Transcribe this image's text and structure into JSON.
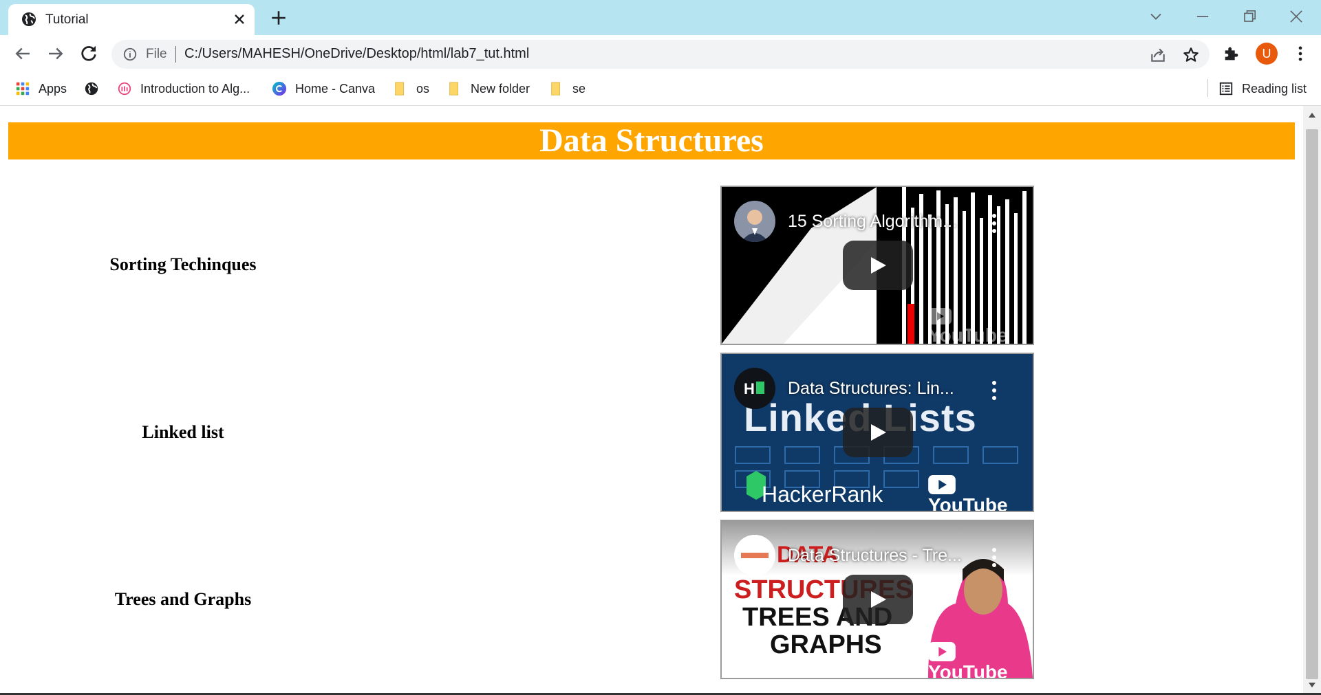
{
  "browser": {
    "tab_title": "Tutorial",
    "address_scheme": "File",
    "address_url": "C:/Users/MAHESH/OneDrive/Desktop/html/lab7_tut.html",
    "profile_initial": "U"
  },
  "bookmarks": {
    "items": [
      {
        "label": "Apps",
        "icon": "apps-grid-icon"
      },
      {
        "label": "",
        "icon": "globe-icon"
      },
      {
        "label": "Introduction to Alg...",
        "icon": "bookmark-site-icon"
      },
      {
        "label": "Home - Canva",
        "icon": "canva-icon"
      },
      {
        "label": "os",
        "icon": "folder-icon"
      },
      {
        "label": "New folder",
        "icon": "folder-icon"
      },
      {
        "label": "se",
        "icon": "folder-icon"
      }
    ],
    "reading_list": "Reading list"
  },
  "page": {
    "heading": "Data Structures",
    "heading_color": "#ffa500",
    "topics": [
      {
        "label": "Sorting Techinques",
        "video_title": "15 Sorting Algorithm..."
      },
      {
        "label": "Linked list",
        "video_title": "Data Structures: Lin...",
        "thumb_big_text": "Linked Lists",
        "thumb_brand": "HackerRank"
      },
      {
        "label": "Trees and Graphs",
        "video_title": "Data Structures - Tre...",
        "thumb_lines": [
          "DATA",
          "STRUCTURES",
          "TREES AND",
          "GRAPHS"
        ]
      }
    ],
    "youtube_label": "YouTube"
  }
}
